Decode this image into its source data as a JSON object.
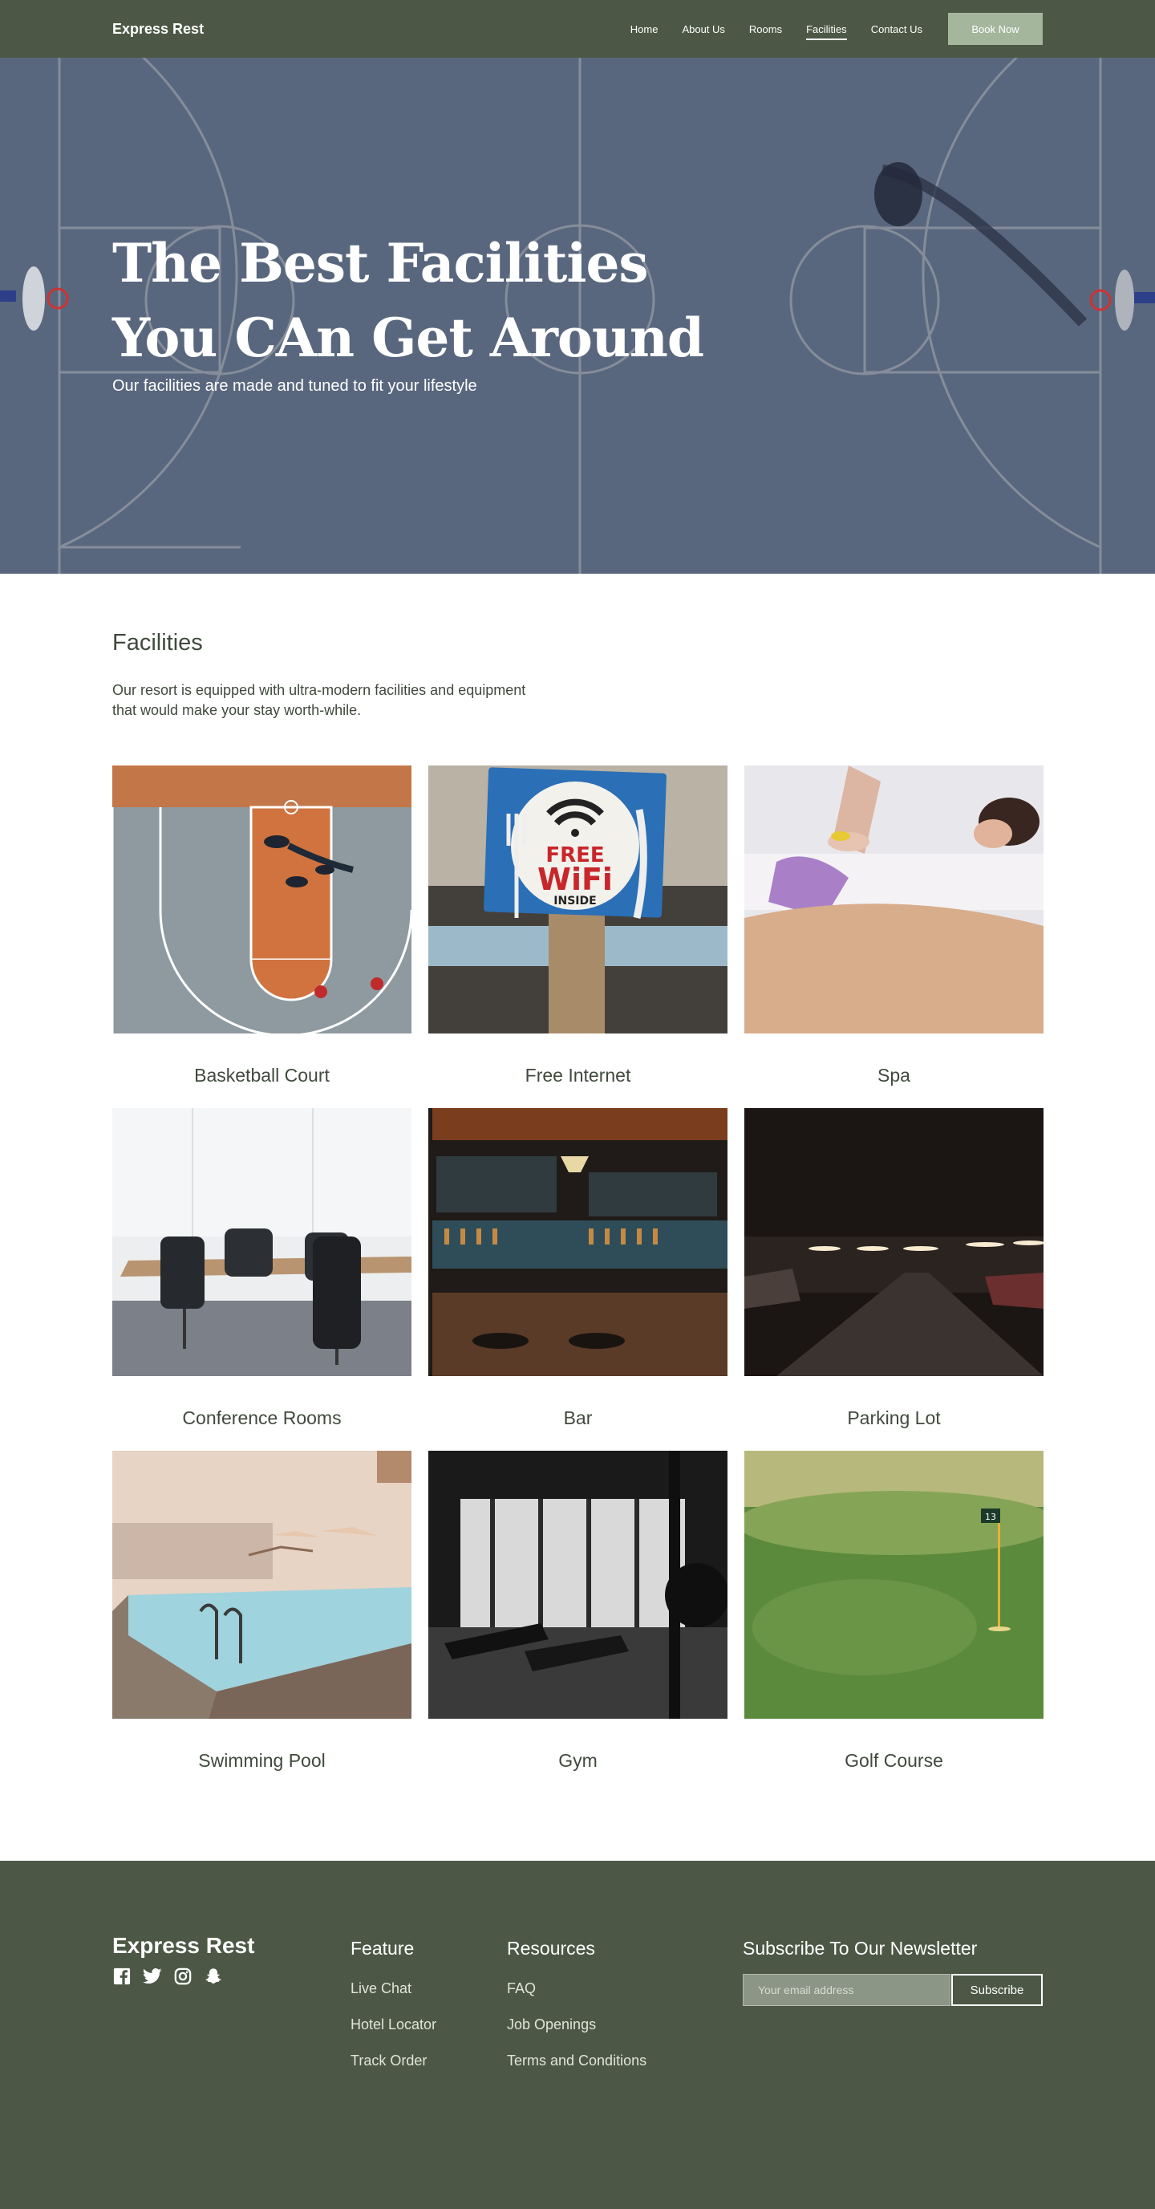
{
  "nav": {
    "brand": "Express Rest",
    "links": [
      "Home",
      "About Us",
      "Rooms",
      "Facilities",
      "Contact Us"
    ],
    "active": "Facilities",
    "cta": "Book Now"
  },
  "hero": {
    "title_line1": "The Best Facilities",
    "title_line2": "You CAn Get Around",
    "subtitle": "Our facilities are made and tuned to fit your lifestyle"
  },
  "facilities": {
    "title": "Facilities",
    "description_line1": "Our resort is equipped with ultra-modern facilities and equipment",
    "description_line2": "that would make your stay worth-while.",
    "items": [
      {
        "label": "Basketball Court"
      },
      {
        "label": "Free Internet",
        "sign_line1": "FREE",
        "sign_line2": "WiFi",
        "sign_line3": "INSIDE"
      },
      {
        "label": "Spa"
      },
      {
        "label": "Conference Rooms"
      },
      {
        "label": "Bar"
      },
      {
        "label": "Parking Lot"
      },
      {
        "label": "Swimming Pool"
      },
      {
        "label": "Gym"
      },
      {
        "label": "Golf Course",
        "flag_number": "13"
      }
    ]
  },
  "footer": {
    "brand": "Express Rest",
    "social_icons": [
      "facebook-icon",
      "twitter-icon",
      "instagram-icon",
      "snapchat-icon"
    ],
    "feature": {
      "title": "Feature",
      "links": [
        "Live Chat",
        "Hotel Locator",
        "Track Order"
      ]
    },
    "resources": {
      "title": "Resources",
      "links": [
        "FAQ",
        "Job Openings",
        "Terms and Conditions"
      ]
    },
    "newsletter": {
      "title": "Subscribe To Our Newsletter",
      "placeholder": "Your email address",
      "button": "Subscribe"
    }
  },
  "colors": {
    "primary": "#4c5845",
    "accent": "#a4b69c",
    "hero_overlay": "#5d6a80",
    "text": "#3f4a3c"
  }
}
